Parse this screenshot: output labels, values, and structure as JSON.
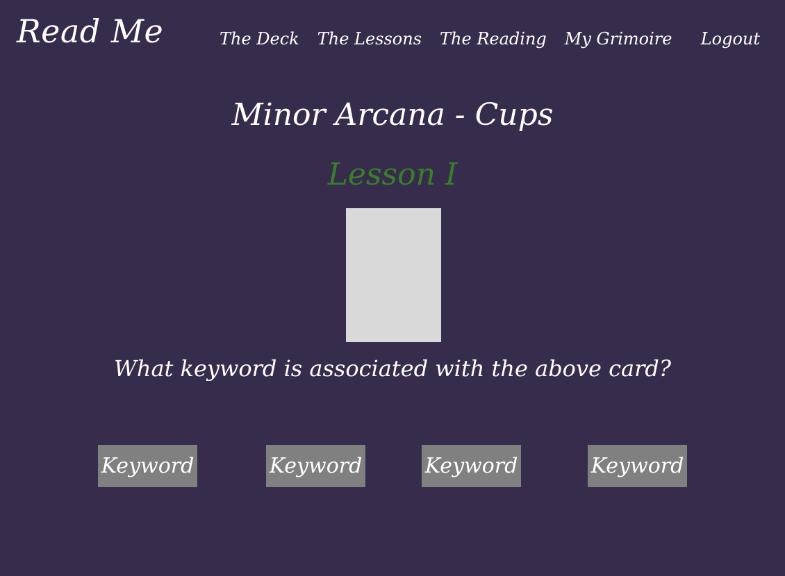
{
  "header": {
    "brand": "Read Me",
    "nav": [
      {
        "label": "The Deck"
      },
      {
        "label": "The Lessons"
      },
      {
        "label": "The Reading"
      },
      {
        "label": "My Grimoire"
      }
    ],
    "logout": "Logout"
  },
  "main": {
    "title": "Minor Arcana - Cups",
    "lesson_title": "Lesson I",
    "question": "What keyword is associated with the above card?",
    "answers": [
      {
        "label": "Keyword"
      },
      {
        "label": "Keyword"
      },
      {
        "label": "Keyword"
      },
      {
        "label": "Keyword"
      }
    ]
  },
  "colors": {
    "background": "#372c4b",
    "lesson_title": "#3a7d2b",
    "card_placeholder": "#d9d9d9",
    "answer_button": "#808080",
    "text": "#ffffff"
  }
}
